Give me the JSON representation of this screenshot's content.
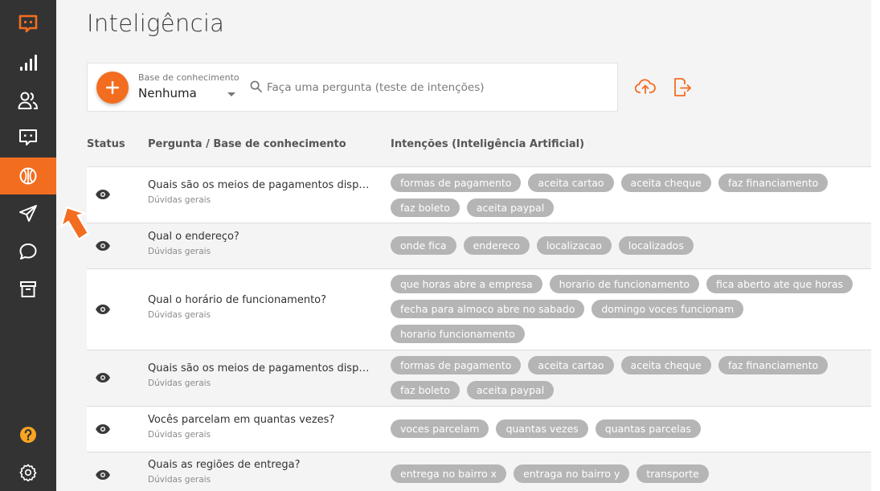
{
  "sidebar": {
    "items": [
      {
        "name": "logo-icon"
      },
      {
        "name": "signal-bars-icon"
      },
      {
        "name": "users-icon"
      },
      {
        "name": "chat-bot-icon"
      },
      {
        "name": "intelligence-icon",
        "active": true
      },
      {
        "name": "send-icon"
      },
      {
        "name": "chat-bubble-icon"
      },
      {
        "name": "archive-icon"
      },
      {
        "name": "help-icon"
      },
      {
        "name": "gear-icon"
      }
    ]
  },
  "page": {
    "title": "Inteligência"
  },
  "search": {
    "kb_label": "Base de conhecimento",
    "kb_value": "Nenhuma",
    "placeholder": "Faça uma pergunta (teste de intenções)"
  },
  "table": {
    "headers": {
      "status": "Status",
      "question": "Pergunta / Base de conhecimento",
      "intents": "Intenções (Inteligência Artificial)"
    },
    "rows": [
      {
        "question": "Quais são os meios de pagamentos dispo...",
        "kb": "Dúvidas gerais",
        "intents": [
          "formas de pagamento",
          "aceita cartao",
          "aceita cheque",
          "faz financiamento",
          "faz boleto",
          "aceita paypal"
        ]
      },
      {
        "question": "Qual o endereço?",
        "kb": "Dúvidas gerais",
        "intents": [
          "onde fica",
          "endereco",
          "localizacao",
          "localizados"
        ]
      },
      {
        "question": "Qual o horário de funcionamento?",
        "kb": "Dúvidas gerais",
        "intents": [
          "que horas abre a empresa",
          "horario de funcionamento",
          "fica aberto ate que horas",
          "fecha para almoco abre no sabado",
          "domingo voces funcionam",
          "horario funcionamento"
        ]
      },
      {
        "question": "Quais são os meios de pagamentos dispo...",
        "kb": "Dúvidas gerais",
        "intents": [
          "formas de pagamento",
          "aceita cartao",
          "aceita cheque",
          "faz financiamento",
          "faz boleto",
          "aceita paypal"
        ]
      },
      {
        "question": "Vocês parcelam em quantas vezes?",
        "kb": "Dúvidas gerais",
        "intents": [
          "voces parcelam",
          "quantas vezes",
          "quantas parcelas"
        ]
      },
      {
        "question": "Quais as regiões de entrega?",
        "kb": "Dúvidas gerais",
        "intents": [
          "entrega no bairro x",
          "entraga no bairro y",
          "transporte"
        ]
      }
    ]
  },
  "colors": {
    "accent": "#f36d21",
    "sidebar": "#333333",
    "tag": "#b5b5b5"
  }
}
